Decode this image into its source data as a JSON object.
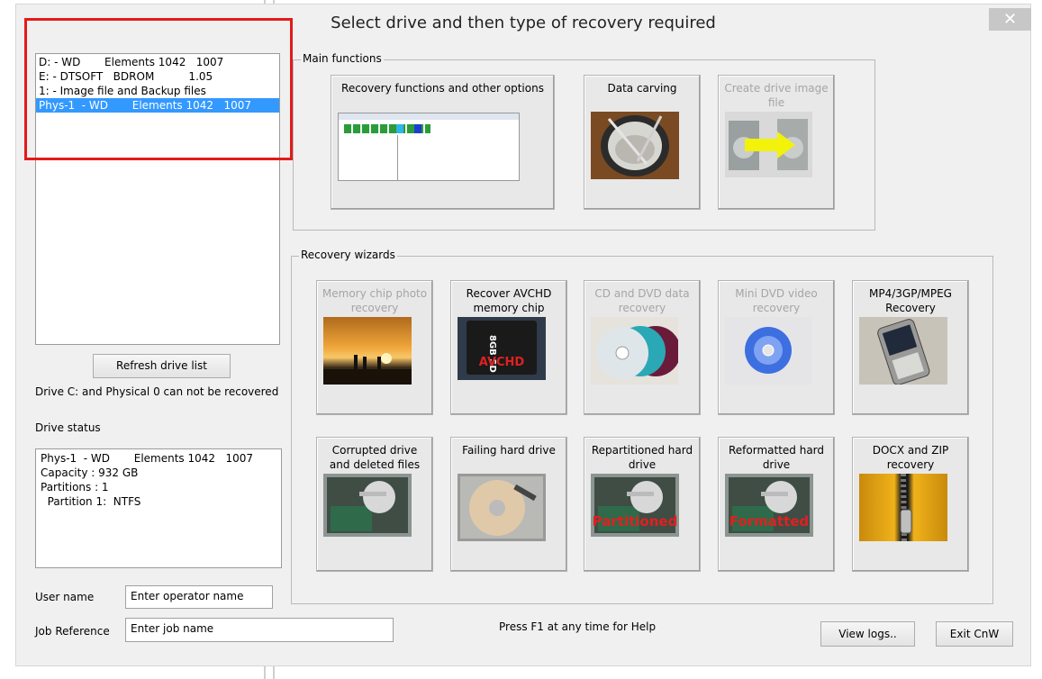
{
  "window": {
    "title": "Select drive and then type of recovery required",
    "close_glyph": "✕"
  },
  "drives": [
    {
      "label": "D: - WD       Elements 1042   1007",
      "selected": false
    },
    {
      "label": "E: - DTSOFT   BDROM          1.05",
      "selected": false
    },
    {
      "label": "1: - Image file and Backup files",
      "selected": false
    },
    {
      "label": "Phys-1  - WD       Elements 1042   1007",
      "selected": true
    }
  ],
  "refresh_label": "Refresh drive list",
  "drive_note": "Drive C: and Physical 0 can not be recovered",
  "drive_status": {
    "heading": "Drive status",
    "text": "Phys-1  - WD       Elements 1042   1007\nCapacity : 932 GB\nPartitions : 1\n  Partition 1:  NTFS"
  },
  "user_name": {
    "label": "User name",
    "placeholder": "Enter operator name",
    "value": "Enter operator name"
  },
  "job_reference": {
    "label": "Job Reference",
    "placeholder": "Enter job name",
    "value": "Enter job name"
  },
  "main_functions": {
    "heading": "Main functions",
    "tiles": [
      {
        "label": "Recovery functions and other options",
        "enabled": true,
        "icon": "screenshot-thumbnail"
      },
      {
        "label": "Data carving",
        "enabled": true,
        "icon": "plate-and-fork"
      },
      {
        "label": "Create drive image file",
        "enabled": false,
        "icon": "drive-copy-arrow"
      }
    ]
  },
  "recovery_wizards": {
    "heading": "Recovery wizards",
    "tiles": [
      {
        "label": "Memory chip photo recovery",
        "enabled": false,
        "icon": "sunset-photo"
      },
      {
        "label": "Recover AVCHD memory chip",
        "enabled": true,
        "icon": "sd-card",
        "overlay": "AVCHD",
        "card_text": "8GB SD"
      },
      {
        "label": "CD and DVD data recovery",
        "enabled": false,
        "icon": "discs"
      },
      {
        "label": "Mini DVD video recovery",
        "enabled": false,
        "icon": "mini-dvd"
      },
      {
        "label": "MP4/3GP/MPEG Recovery",
        "enabled": true,
        "icon": "mobile-phone"
      },
      {
        "label": "Corrupted drive and deleted files",
        "enabled": true,
        "icon": "hard-drive"
      },
      {
        "label": "Failing hard drive",
        "enabled": true,
        "icon": "hard-drive-platter"
      },
      {
        "label": "Repartitioned hard drive",
        "enabled": true,
        "icon": "hard-drive",
        "overlay": "Partitioned"
      },
      {
        "label": "Reformatted hard drive",
        "enabled": true,
        "icon": "hard-drive",
        "overlay": "Formatted"
      },
      {
        "label": "DOCX and ZIP recovery",
        "enabled": true,
        "icon": "zipper"
      }
    ]
  },
  "help_text": "Press F1 at any time for Help",
  "view_logs_label": "View logs..",
  "exit_label": "Exit CnW",
  "colors": {
    "selection": "#3399ff",
    "highlight_border": "#e21b1b",
    "overlay_text": "#e02020",
    "dialog_bg": "#f0f0f0"
  }
}
